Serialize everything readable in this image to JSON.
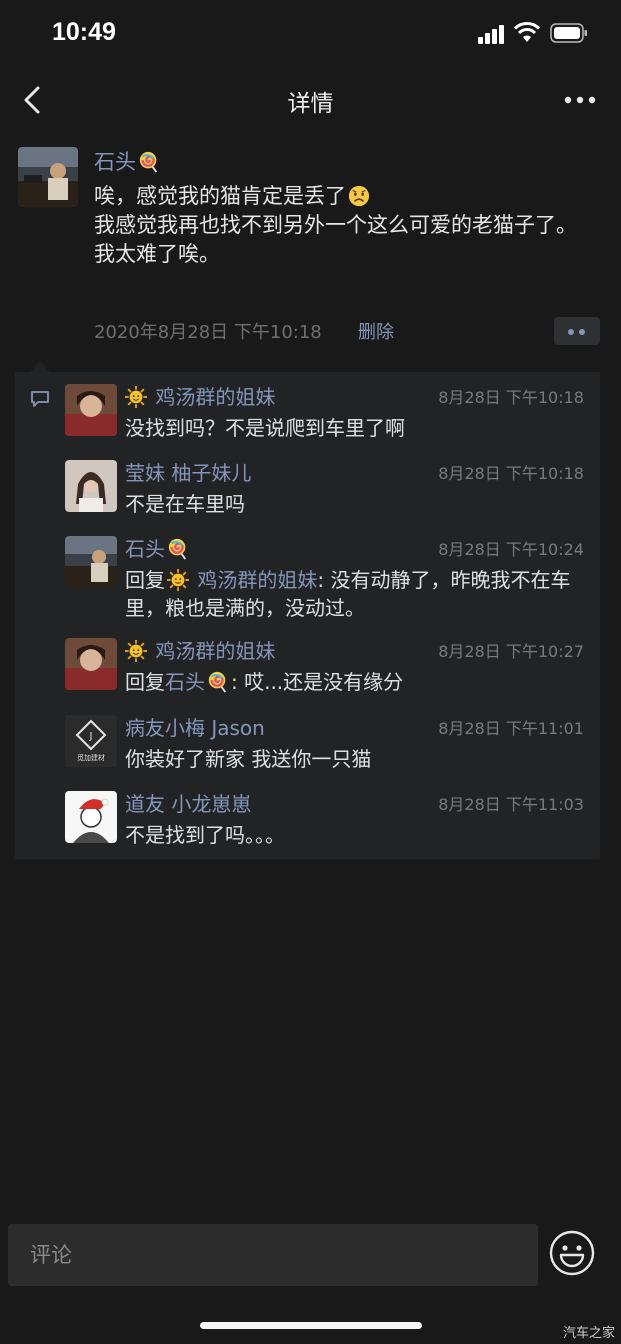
{
  "status": {
    "time": "10:49"
  },
  "nav": {
    "title": "详情"
  },
  "post": {
    "author": "石头",
    "lines": [
      "唉，感觉我的猫肯定是丢了",
      "我感觉我再也找不到另外一个这么可爱的老猫子了。",
      "我太难了唉。"
    ],
    "timestamp": "2020年8月28日 下午10:18",
    "delete_label": "删除"
  },
  "comments": [
    {
      "name": "鸡汤群的姐妹",
      "time": "8月28日 下午10:18",
      "text": "没找到吗？不是说爬到车里了啊"
    },
    {
      "name": "莹妹 柚子妹儿",
      "time": "8月28日 下午10:18",
      "text": "不是在车里吗"
    },
    {
      "name": "石头",
      "time": "8月28日 下午10:24",
      "reply_prefix": "回复",
      "reply_to": "鸡汤群的姐妹",
      "text": ": 没有动静了，昨晚我不在车里，粮也是满的，没动过。"
    },
    {
      "name": "鸡汤群的姐妹",
      "time": "8月28日 下午10:27",
      "reply_prefix": "回复",
      "reply_to": "石头",
      "text": ": 哎...还是没有缘分"
    },
    {
      "name": "病友小梅 Jason",
      "time": "8月28日 下午11:01",
      "text": "你装好了新家 我送你一只猫",
      "avatar_text": "觅加建材"
    },
    {
      "name": "道友 小龙崽崽",
      "time": "8月28日 下午11:03",
      "text": "不是找到了吗。。。"
    }
  ],
  "input": {
    "placeholder": "评论"
  },
  "watermark": "汽车之家",
  "colors": {
    "background": "#191919",
    "link": "#8496bb",
    "panel": "#222325"
  },
  "icons": [
    "back-icon",
    "more-icon",
    "comment-icon",
    "lollipop-emoji-icon",
    "sun-emoji-icon",
    "frown-emoji-icon",
    "smiley-icon"
  ]
}
